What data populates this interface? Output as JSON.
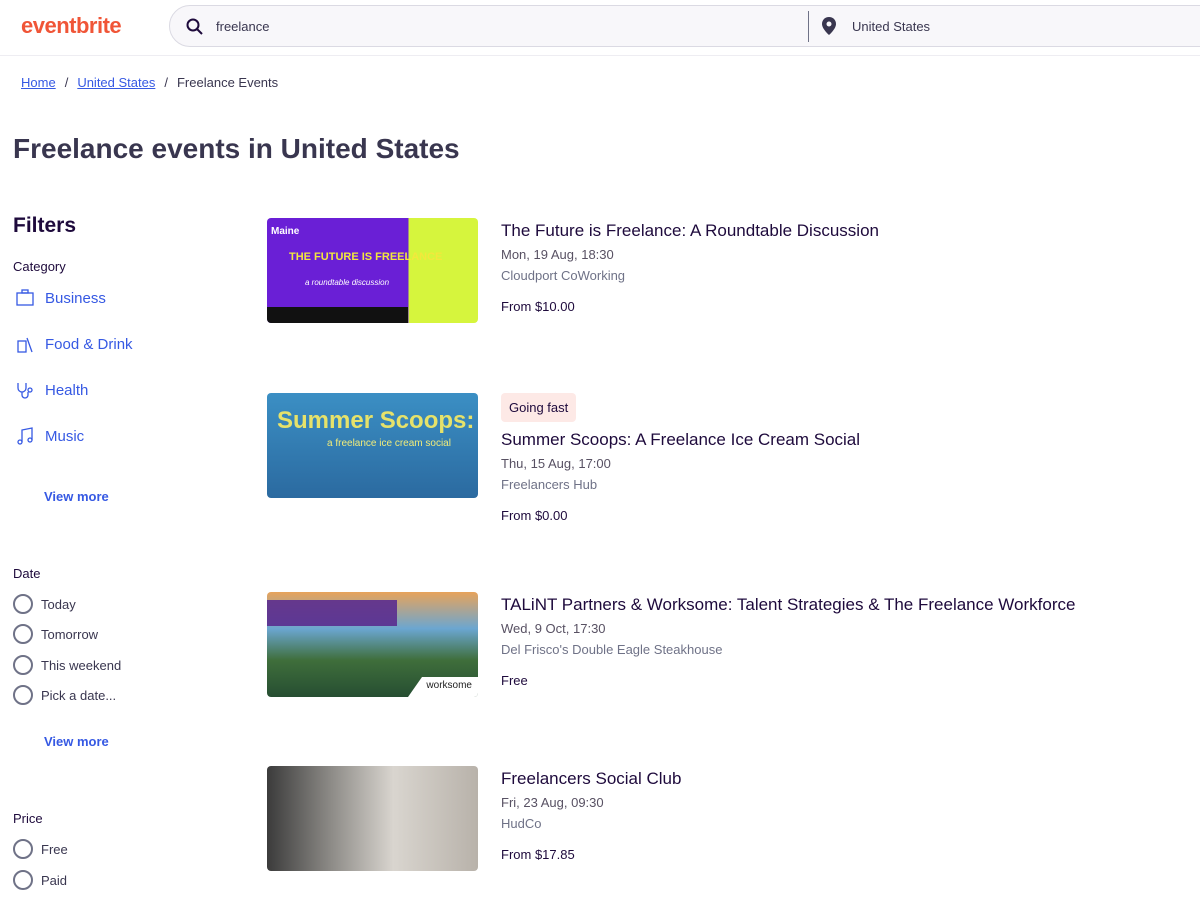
{
  "header": {
    "logo": "eventbrite",
    "search_value": "freelance",
    "location_value": "United States"
  },
  "breadcrumb": [
    {
      "label": "Home"
    },
    {
      "label": "United States"
    },
    {
      "label": "Freelance Events"
    }
  ],
  "page_title": "Freelance events in United States",
  "filters": {
    "title": "Filters",
    "category": {
      "label": "Category",
      "items": [
        {
          "label": "Business",
          "icon": "briefcase-icon"
        },
        {
          "label": "Food & Drink",
          "icon": "food-drink-icon"
        },
        {
          "label": "Health",
          "icon": "stethoscope-icon"
        },
        {
          "label": "Music",
          "icon": "music-note-icon"
        }
      ],
      "view_more": "View more"
    },
    "date": {
      "label": "Date",
      "options": [
        "Today",
        "Tomorrow",
        "This weekend",
        "Pick a date..."
      ],
      "view_more": "View more"
    },
    "price": {
      "label": "Price",
      "options": [
        "Free",
        "Paid"
      ]
    }
  },
  "events": [
    {
      "title": "The Future is Freelance: A Roundtable Discussion",
      "date": "Mon, 19 Aug, 18:30",
      "venue": "Cloudport CoWorking",
      "price": "From $10.00",
      "image_text": "THE FUTURE IS FREELANCE",
      "image_sub": "a roundtable discussion",
      "image_brand": "Maine"
    },
    {
      "badge": "Going fast",
      "title": "Summer Scoops: A Freelance Ice Cream Social",
      "date": "Thu, 15 Aug, 17:00",
      "venue": "Freelancers Hub",
      "price": "From $0.00",
      "image_text": "Summer Scoops:",
      "image_sub": "a freelance ice cream social"
    },
    {
      "title": "TALiNT Partners & Worksome: Talent Strategies & The Freelance Workforce",
      "date": "Wed, 9 Oct, 17:30",
      "venue": "Del Frisco's Double Eagle Steakhouse",
      "price": "Free",
      "image_brand": "worksome"
    },
    {
      "title": "Freelancers Social Club",
      "date": "Fri, 23 Aug, 09:30",
      "venue": "HudCo",
      "price": "From $17.85"
    }
  ],
  "colors": {
    "brand": "#f05537",
    "link": "#3659e3",
    "badge_bg": "#fde9e6"
  }
}
